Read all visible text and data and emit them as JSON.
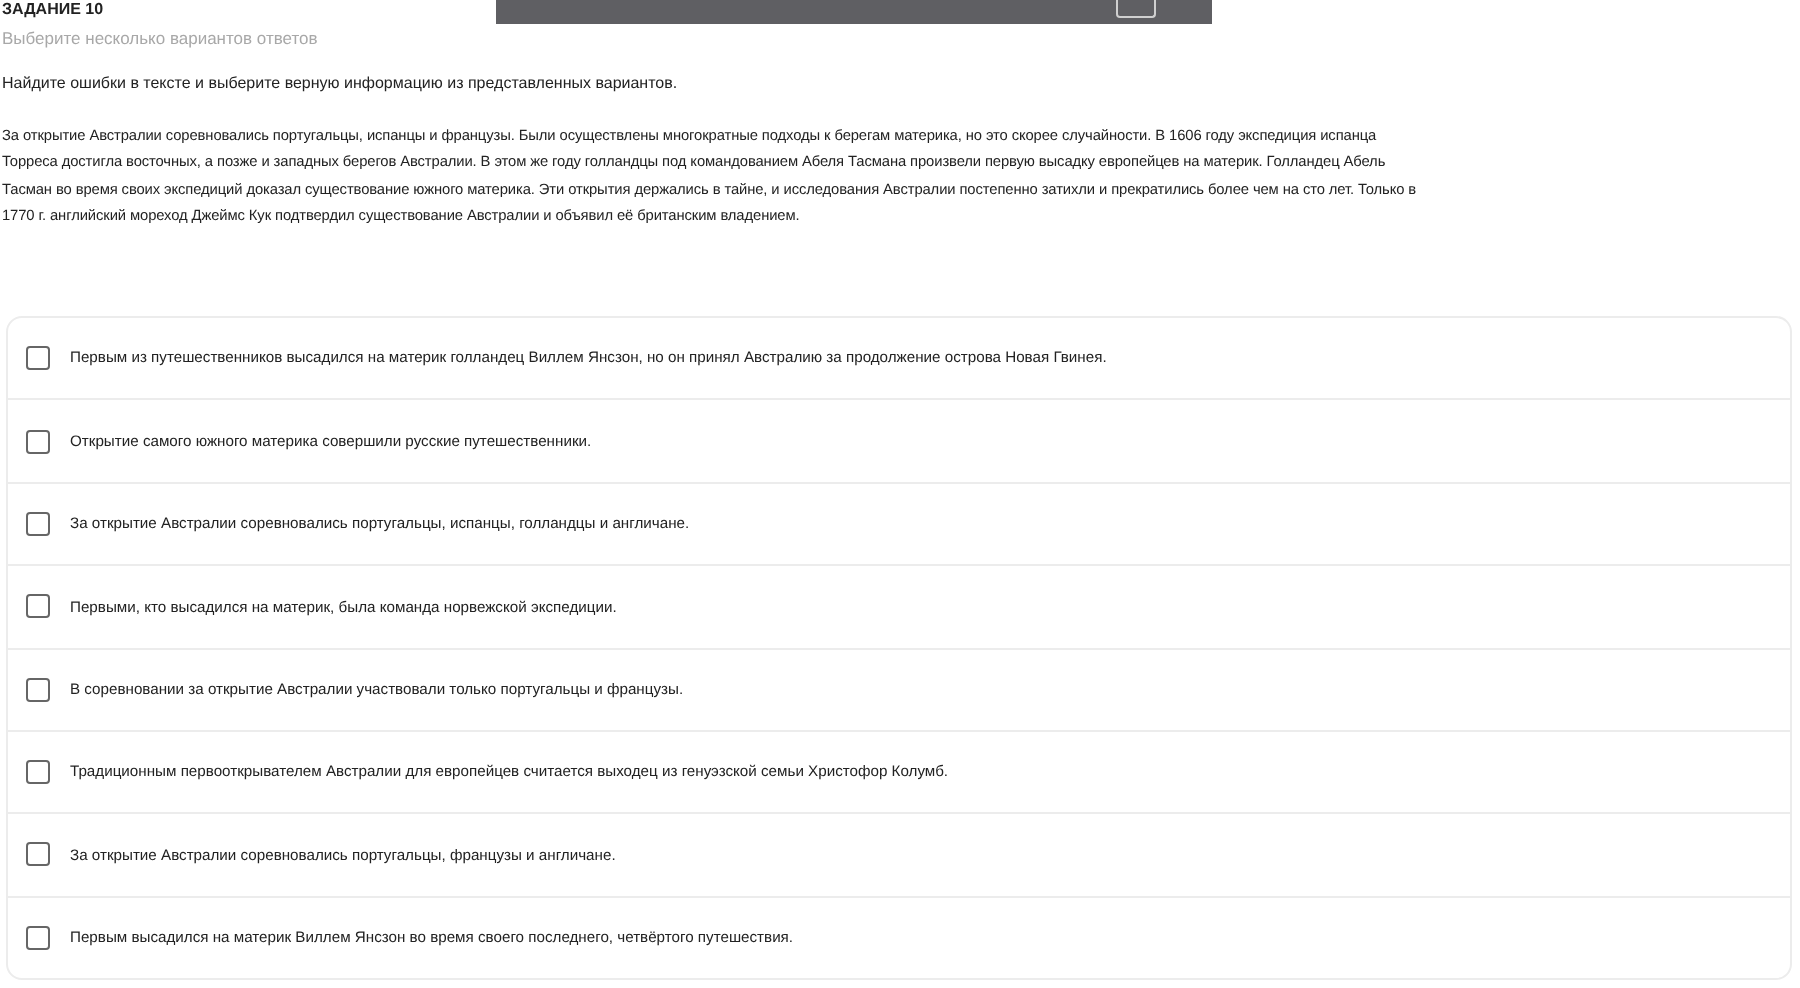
{
  "task": {
    "title": "ЗАДАНИЕ 10",
    "hint": "Выберите несколько вариантов ответов"
  },
  "instruction": "Найдите ошибки в тексте и выберите верную информацию из представленных вариантов.",
  "passage_lines": [
    "За открытие Австралии соревновались португальцы, испанцы и французы. Были осуществлены многократные подходы к берегам материка, но это скорее случайности. В 1606 году экспедиция испанца",
    "Торреса достигла восточных, а позже и западных берегов Австралии. В этом же году голландцы под командованием Абеля Тасмана произвели первую высадку европейцев на материк. Голландец Абель",
    "Тасман во время своих экспедиций доказал существование южного материка. Эти открытия держались в тайне, и исследования Австралии постепенно затихли и прекратились более чем на сто лет. Только в",
    "1770 г. английский мореход Джеймс Кук подтвердил существование Австралии и объявил её британским владением."
  ],
  "options": [
    {
      "label": "Первым из путешественников высадился на материк голландец Виллем Янсзон, но он принял Австралию за продолжение острова Новая Гвинея.",
      "checked": false
    },
    {
      "label": "Открытие самого южного материка совершили русские путешественники.",
      "checked": false
    },
    {
      "label": "За открытие Австралии соревновались португальцы, испанцы, голландцы и англичане.",
      "checked": false
    },
    {
      "label": "Первыми, кто высадился на материк, была команда норвежской экспедиции.",
      "checked": false
    },
    {
      "label": "В соревновании за открытие Австралии участвовали только португальцы и французы.",
      "checked": false
    },
    {
      "label": "Традиционным первооткрывателем Австралии для европейцев считается выходец из генуэзской семьи Христофор Колумб.",
      "checked": false
    },
    {
      "label": "За открытие Австралии соревновались португальцы, французы и англичане.",
      "checked": false
    },
    {
      "label": "Первым высадился на материк Виллем Янсзон во время своего последнего, четвёртого путешествия.",
      "checked": false
    }
  ]
}
